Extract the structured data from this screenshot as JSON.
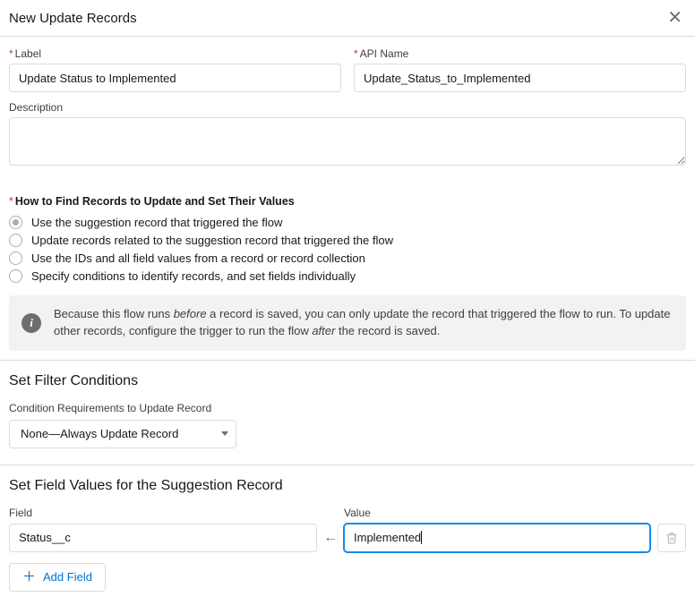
{
  "header": {
    "title": "New Update Records"
  },
  "basic": {
    "label_label": "Label",
    "label_value": "Update Status to Implemented",
    "apiname_label": "API Name",
    "apiname_value": "Update_Status_to_Implemented",
    "desc_label": "Description",
    "desc_value": ""
  },
  "findRecords": {
    "heading": "How to Find Records to Update and Set Their Values",
    "options": [
      "Use the suggestion record that triggered the flow",
      "Update records related to the suggestion record that triggered the flow",
      "Use the IDs and all field values from a record or record collection",
      "Specify conditions to identify records, and set fields individually"
    ],
    "selected_index": 0,
    "info_pre": "Because this flow runs ",
    "info_before": "before",
    "info_mid": " a record is saved, you can only update the record that triggered the flow to run. To update other records, configure the trigger to run the flow ",
    "info_after": "after",
    "info_post": " the record is saved."
  },
  "filter": {
    "title": "Set Filter Conditions",
    "cond_label": "Condition Requirements to Update Record",
    "cond_value": "None—Always Update Record"
  },
  "fieldValues": {
    "title": "Set Field Values for the Suggestion Record",
    "field_label": "Field",
    "value_label": "Value",
    "rows": [
      {
        "field": "Status__c",
        "value": "Implemented"
      }
    ],
    "add_label": "Add Field"
  }
}
